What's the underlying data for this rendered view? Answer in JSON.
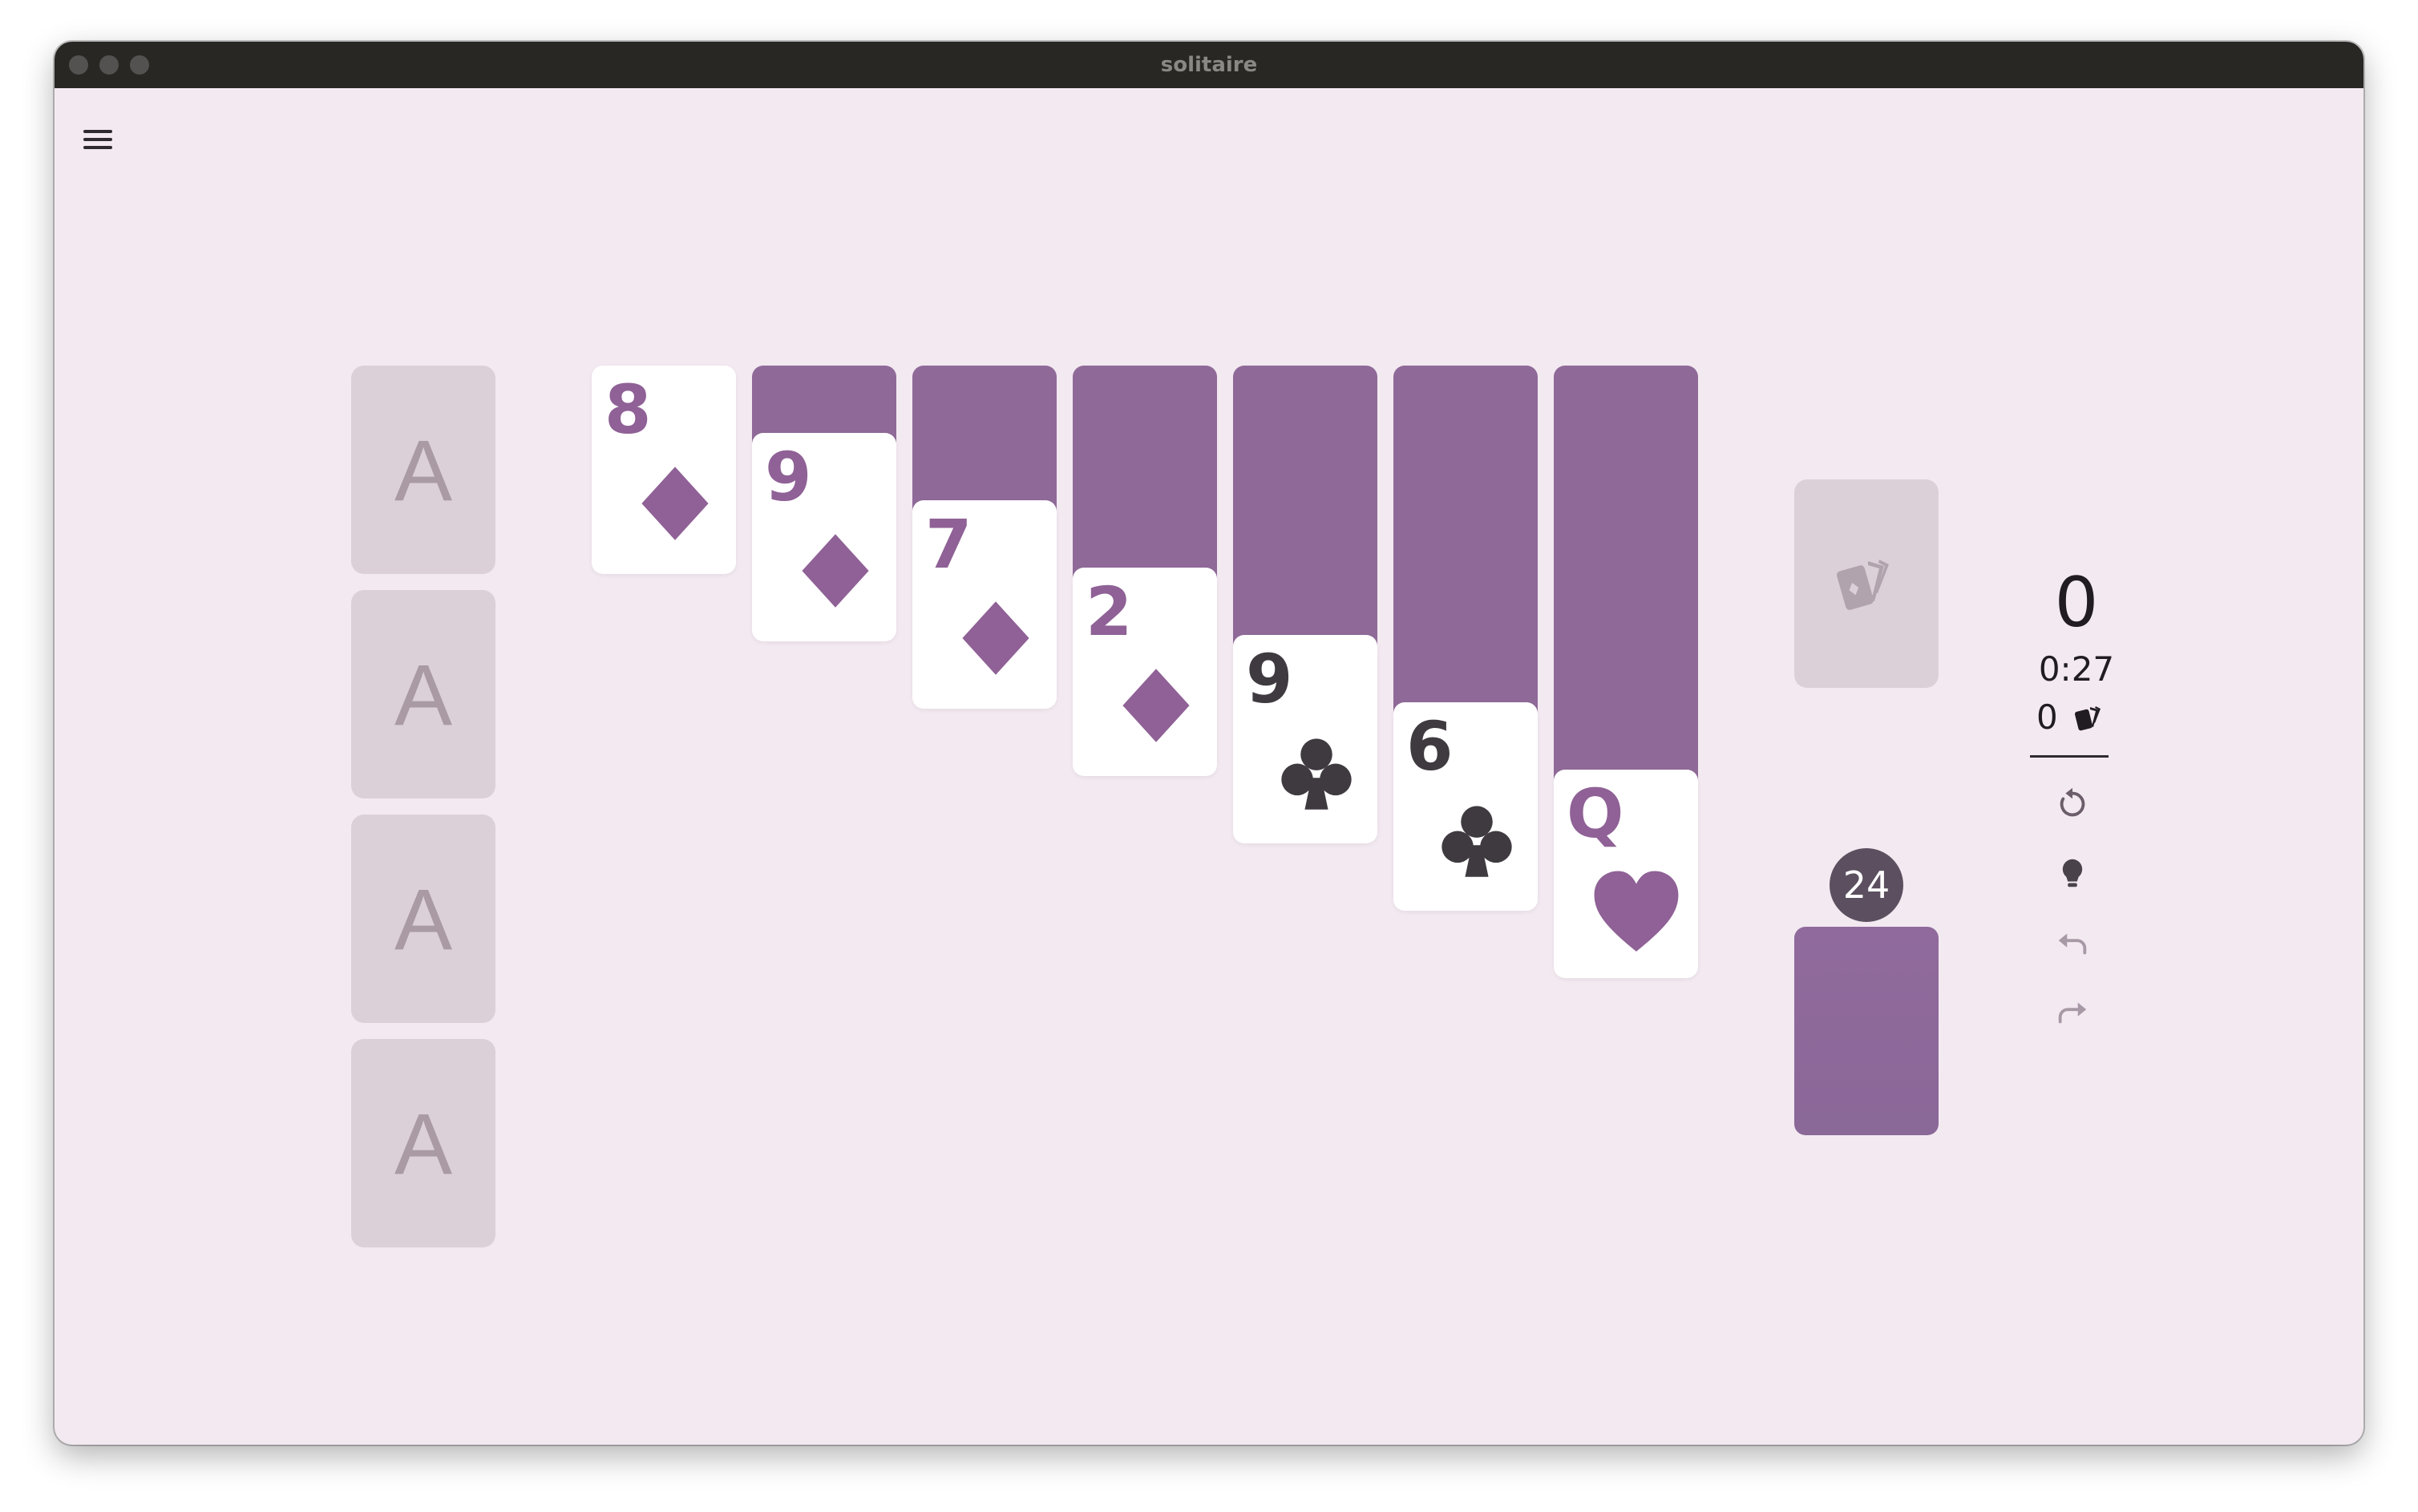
{
  "window": {
    "title": "solitaire"
  },
  "menu": {
    "icon": "hamburger-menu-icon"
  },
  "foundations": [
    {
      "label": "A"
    },
    {
      "label": "A"
    },
    {
      "label": "A"
    },
    {
      "label": "A"
    }
  ],
  "tableau": [
    {
      "face_down": 0,
      "face_up": {
        "rank": "8",
        "suit": "diamonds",
        "color": "purple"
      }
    },
    {
      "face_down": 1,
      "face_up": {
        "rank": "9",
        "suit": "diamonds",
        "color": "purple"
      }
    },
    {
      "face_down": 2,
      "face_up": {
        "rank": "7",
        "suit": "diamonds",
        "color": "purple"
      }
    },
    {
      "face_down": 3,
      "face_up": {
        "rank": "2",
        "suit": "diamonds",
        "color": "purple"
      }
    },
    {
      "face_down": 4,
      "face_up": {
        "rank": "9",
        "suit": "clubs",
        "color": "dark"
      }
    },
    {
      "face_down": 5,
      "face_up": {
        "rank": "6",
        "suit": "clubs",
        "color": "dark"
      }
    },
    {
      "face_down": 6,
      "face_up": {
        "rank": "Q",
        "suit": "hearts",
        "color": "purple"
      }
    }
  ],
  "waste": {
    "icon": "cards-icon"
  },
  "stock": {
    "count": "24"
  },
  "stats": {
    "score": "0",
    "time": "0:27",
    "moves": "0",
    "moves_icon": "cards-icon"
  },
  "controls": [
    {
      "name": "new-game",
      "icon": "restart-icon"
    },
    {
      "name": "hint",
      "icon": "lightbulb-icon"
    },
    {
      "name": "undo",
      "icon": "undo-icon"
    },
    {
      "name": "redo",
      "icon": "redo-icon"
    }
  ],
  "colors": {
    "background": "#f3e9f1",
    "card_back": "#8f6a98",
    "red_suit": "#8f6196",
    "black_suit": "#3f3a40",
    "empty_slot": "#dcd0d8"
  }
}
